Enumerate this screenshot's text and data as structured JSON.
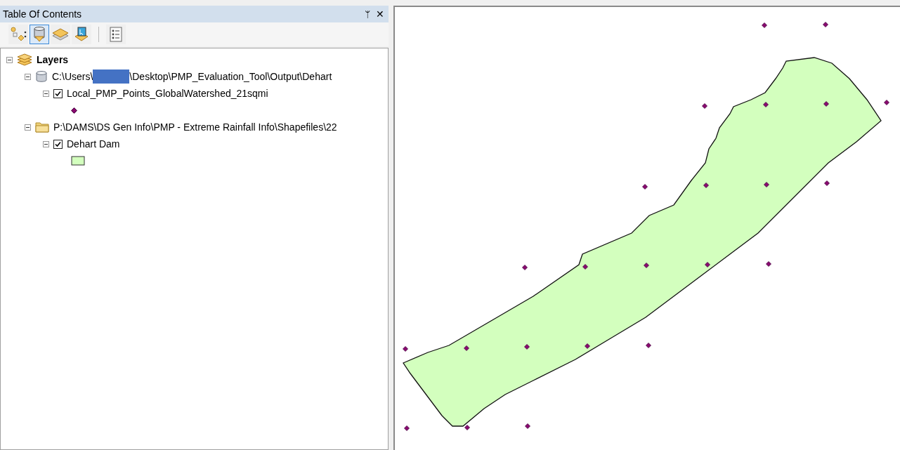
{
  "panel": {
    "title": "Table Of Contents",
    "pin": "ᛘ",
    "close": "✕"
  },
  "toolbar": [
    {
      "kind": "drawing-order",
      "selected": false
    },
    {
      "kind": "source",
      "selected": true
    },
    {
      "kind": "visibility",
      "selected": false
    },
    {
      "kind": "selection",
      "selected": false
    },
    {
      "kind": "options",
      "selected": false
    }
  ],
  "tree": {
    "kind": "frame",
    "label": "Layers",
    "expanded": true,
    "children": [
      {
        "kind": "database",
        "label_start": "C:\\Users\\",
        "redacted": true,
        "label": "\\Desktop\\PMP_Evaluation_Tool\\Output\\Dehart",
        "expanded": true,
        "children": [
          {
            "kind": "layer",
            "label": "Local_PMP_Points_GlobalWatershed_21sqmi",
            "checked": true,
            "expanded": true,
            "legend": {
              "kind": "point"
            }
          }
        ]
      },
      {
        "kind": "folder",
        "label": "P:\\DAMS\\DS Gen Info\\PMP - Extreme Rainfall Info\\Shapefiles\\22",
        "expanded": true,
        "children": [
          {
            "kind": "layer",
            "label": "Dehart Dam",
            "checked": true,
            "expanded": true,
            "legend": {
              "kind": "polygon"
            }
          }
        ]
      }
    ]
  }
}
